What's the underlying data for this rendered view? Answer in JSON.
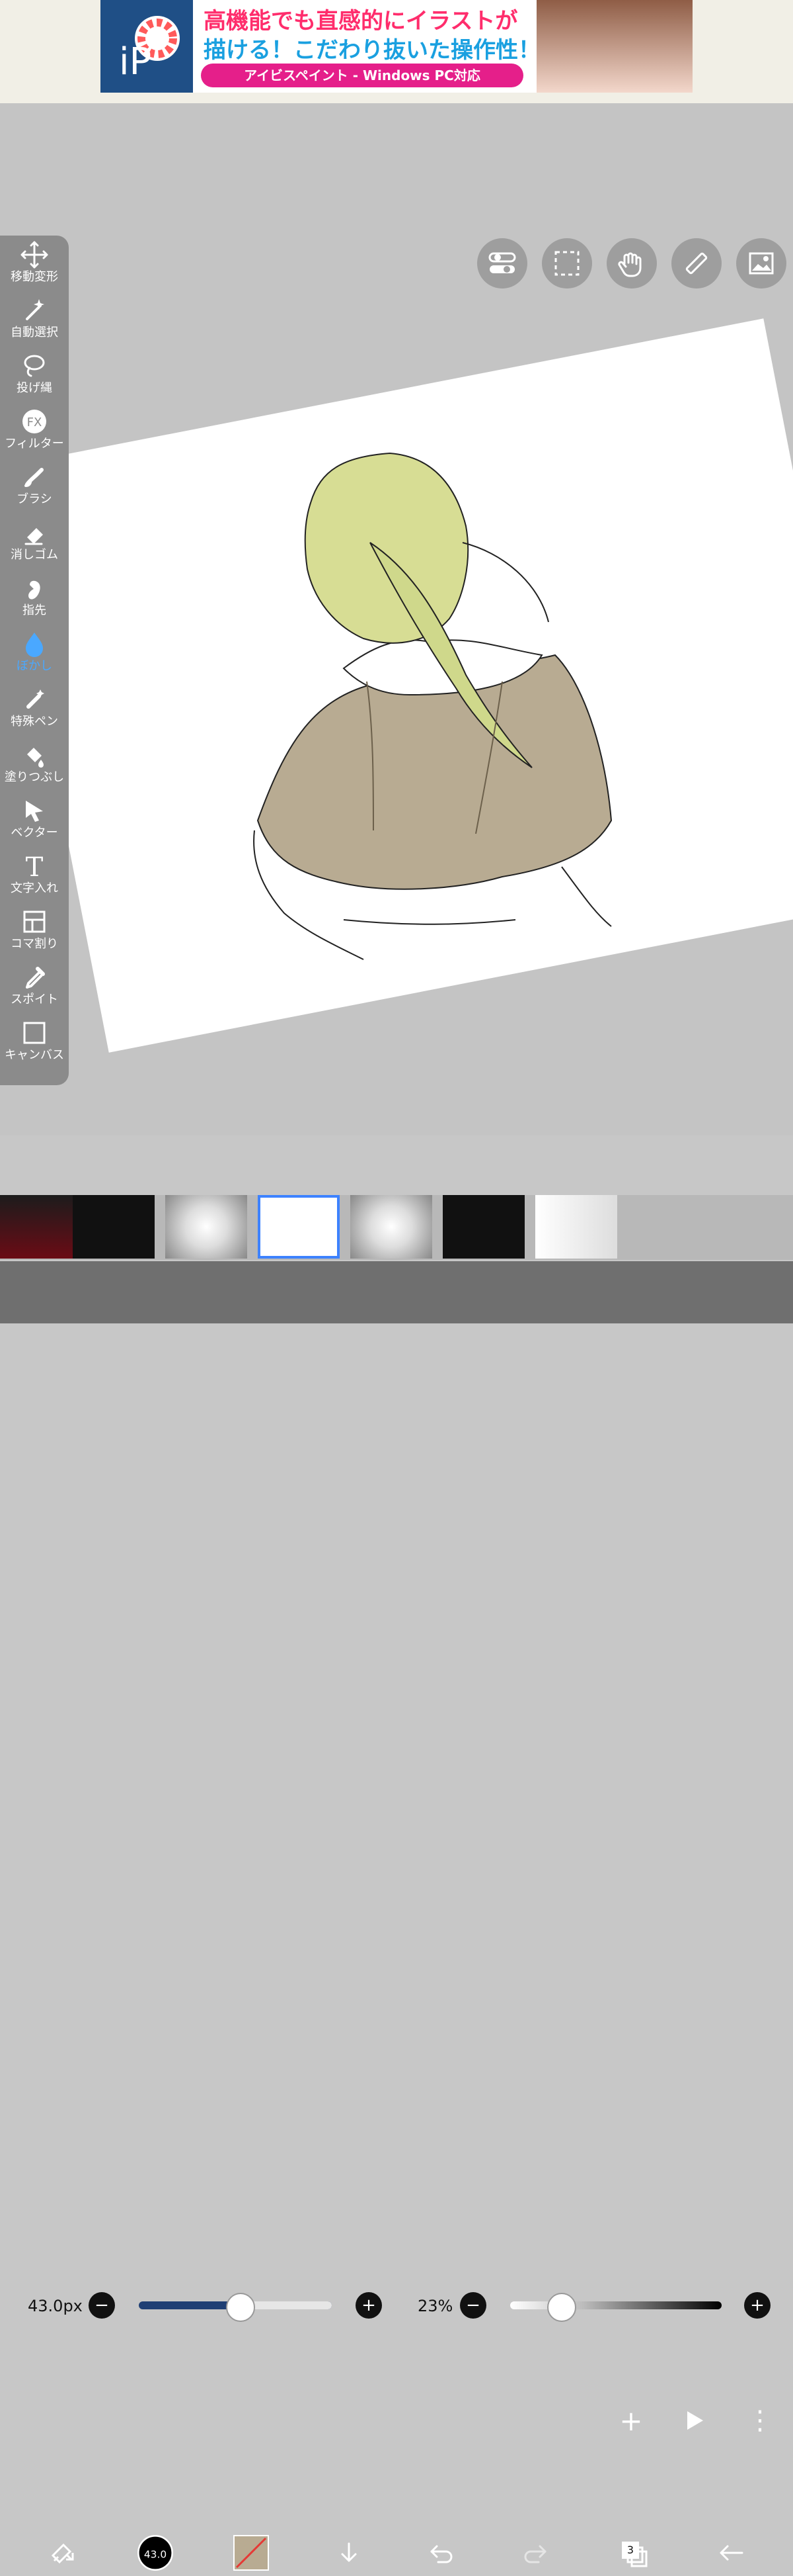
{
  "ad": {
    "line1": "高機能でも直感的にイラストが",
    "line2": "描ける！こだわり抜いた操作性！",
    "line3": "アイビスペイント - Windows PC対応",
    "logo_text": "iP"
  },
  "top_tools": [
    "toggle-icon",
    "selection-icon",
    "hand-icon",
    "ruler-icon",
    "image-icon"
  ],
  "toolbar": {
    "items": [
      {
        "label": "移動変形",
        "icon": "move-icon"
      },
      {
        "label": "自動選択",
        "icon": "magic-wand-icon"
      },
      {
        "label": "投げ縄",
        "icon": "lasso-icon"
      },
      {
        "label": "フィルター",
        "icon": "filter-icon",
        "icon_text": "FX"
      },
      {
        "label": "ブラシ",
        "icon": "brush-icon"
      },
      {
        "label": "消しゴム",
        "icon": "eraser-icon"
      },
      {
        "label": "指先",
        "icon": "finger-icon"
      },
      {
        "label": "ぼかし",
        "icon": "blur-icon",
        "active": true
      },
      {
        "label": "特殊ペン",
        "icon": "special-pen-icon"
      },
      {
        "label": "塗りつぶし",
        "icon": "fill-icon"
      },
      {
        "label": "ベクター",
        "icon": "vector-icon"
      },
      {
        "label": "文字入れ",
        "icon": "text-icon",
        "icon_text": "T"
      },
      {
        "label": "コマ割り",
        "icon": "panel-icon"
      },
      {
        "label": "スポイト",
        "icon": "eyedropper-icon"
      },
      {
        "label": "キャンバス",
        "icon": "canvas-icon"
      }
    ]
  },
  "controls": {
    "brush_size": "43.0px",
    "opacity": "23%",
    "brush_size_level": 0.52,
    "opacity_level": 0.23,
    "minus": "−",
    "plus": "+"
  },
  "filmstrip": {
    "frames": [
      "frame-1",
      "frame-2",
      "frame-3",
      "frame-4",
      "frame-5",
      "frame-6",
      "frame-7"
    ],
    "selected_index": 3,
    "add_label": "+",
    "more_label": "⋮"
  },
  "bottom_bar": {
    "brush_size_display": "43.0",
    "layer_count": "3"
  },
  "colors": {
    "accent": "#4aa8ff",
    "selected_frame": "#3d82ff"
  }
}
